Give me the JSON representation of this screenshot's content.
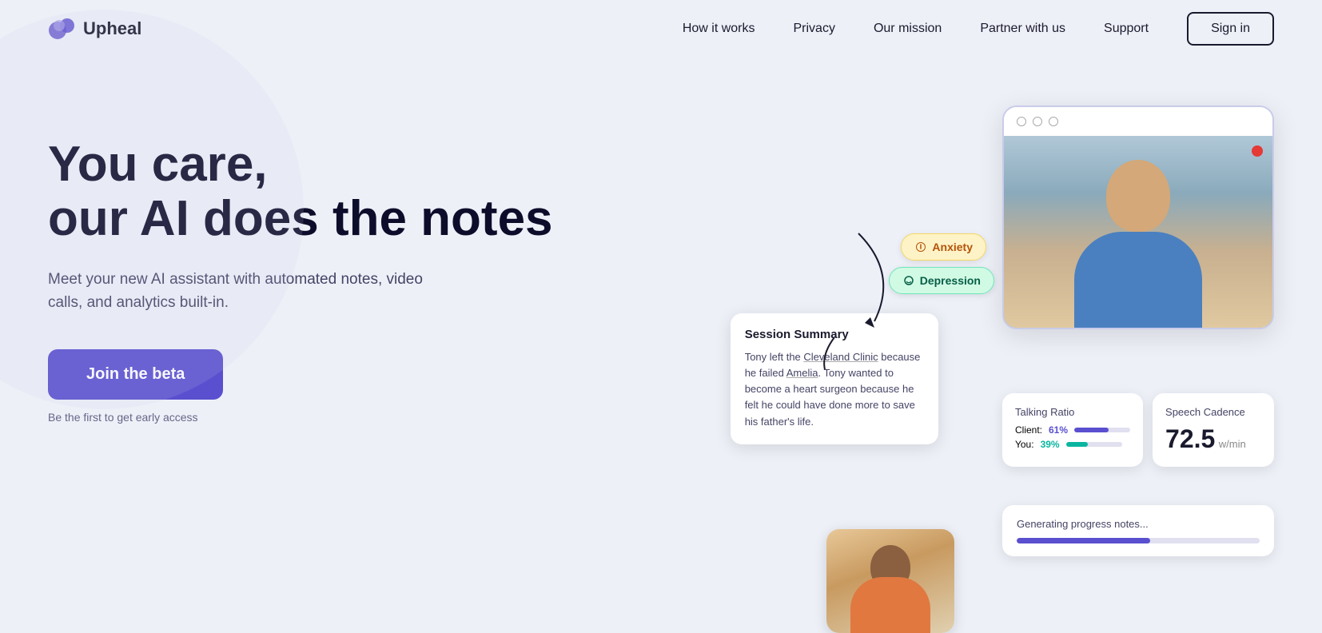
{
  "brand": {
    "name": "Upheal"
  },
  "nav": {
    "links": [
      {
        "label": "How it works",
        "href": "#"
      },
      {
        "label": "Privacy",
        "href": "#"
      },
      {
        "label": "Our mission",
        "href": "#"
      },
      {
        "label": "Partner with us",
        "href": "#"
      },
      {
        "label": "Support",
        "href": "#"
      }
    ],
    "sign_in": "Sign in"
  },
  "hero": {
    "title_line1": "You care,",
    "title_line2": "our AI does the notes",
    "subtitle": "Meet your new AI assistant with automated notes, video calls, and analytics built-in.",
    "cta_button": "Join the beta",
    "cta_sub": "Be the first to get early access"
  },
  "tags": {
    "anxiety": "Anxiety",
    "depression": "Depression"
  },
  "session_summary": {
    "title": "Session Summary",
    "text_parts": [
      "Tony left the ",
      "Cleveland Clinic",
      " because he failed ",
      "Amelia",
      ". Tony wanted to become a heart surgeon because he felt he could have done more to save his father's life."
    ]
  },
  "talking_ratio": {
    "label": "Talking Ratio",
    "client_label": "Client:",
    "client_percent": "61%",
    "client_fill": 61,
    "you_label": "You:",
    "you_percent": "39%",
    "you_fill": 39
  },
  "speech_cadence": {
    "label": "Speech Cadence",
    "value": "72.5",
    "unit": "w/min"
  },
  "progress_notes": {
    "label": "Generating progress notes..."
  },
  "colors": {
    "primary_blue": "#5a4fcf",
    "teal": "#0ab5a0",
    "bg": "#eef0f8",
    "dark": "#0d0d2b"
  }
}
